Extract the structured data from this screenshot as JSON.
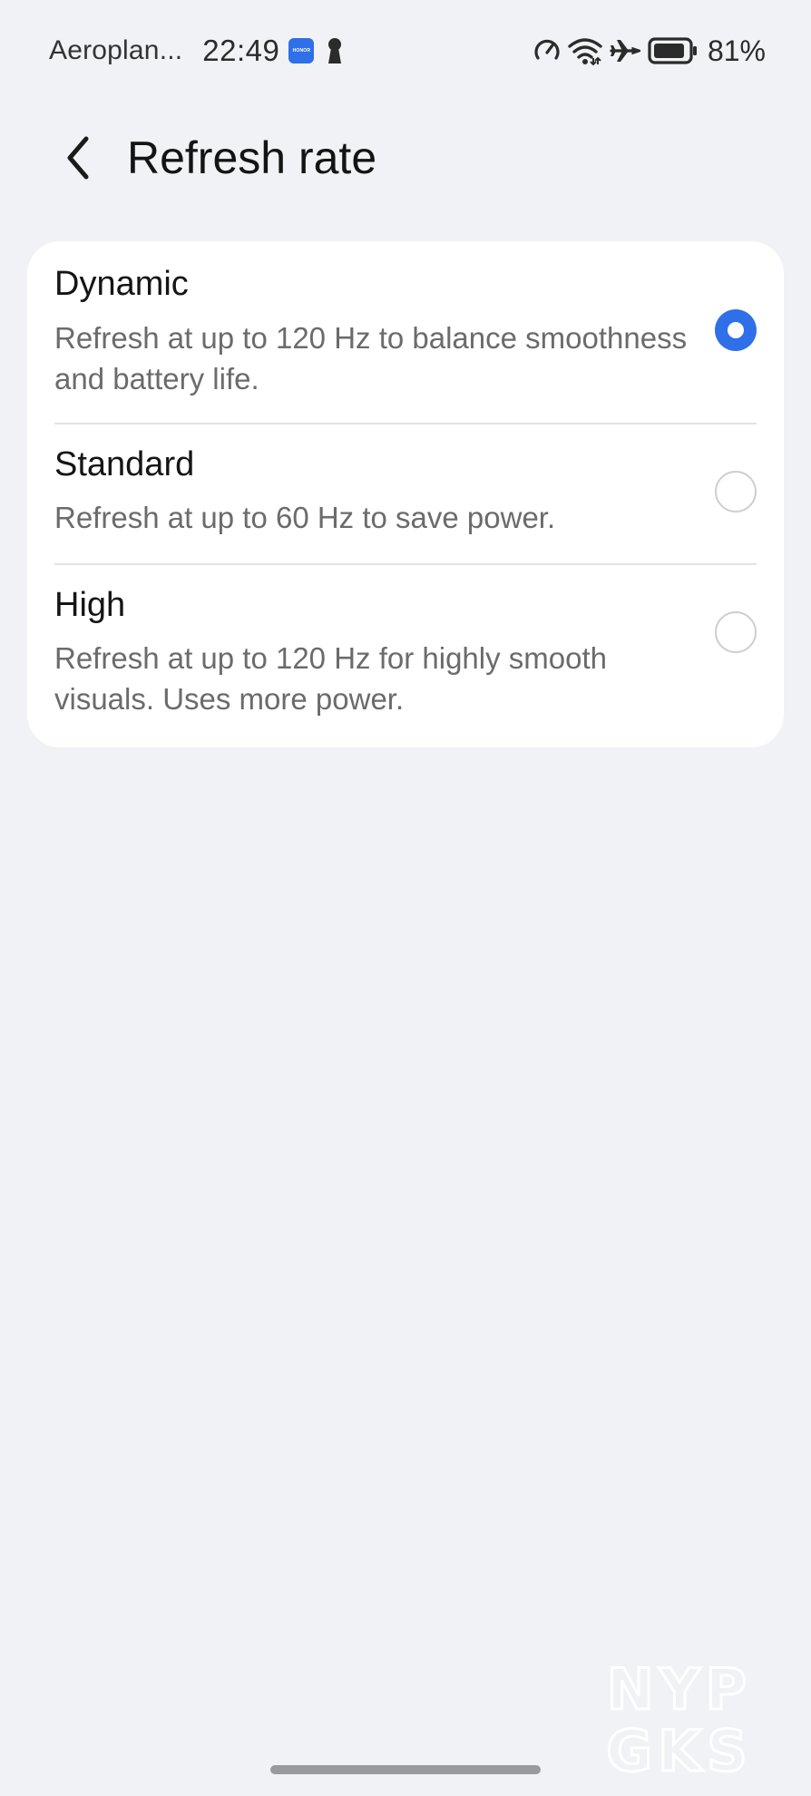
{
  "status_bar": {
    "carrier": "Aeroplan...",
    "time": "22:49",
    "app_badge_label": "HONOR",
    "battery_percent": "81%",
    "icons": [
      "honor-app-icon",
      "keyhole-icon",
      "speed-icon",
      "wifi-icon",
      "airplane-icon",
      "battery-icon"
    ]
  },
  "header": {
    "title": "Refresh rate",
    "back_icon": "chevron-left-icon"
  },
  "options": [
    {
      "title": "Dynamic",
      "description": "Refresh at up to 120 Hz to balance smoothness and battery life.",
      "selected": true
    },
    {
      "title": "Standard",
      "description": "Refresh at up to 60 Hz to save power.",
      "selected": false
    },
    {
      "title": "High",
      "description": "Refresh at up to 120 Hz for highly smooth visuals. Uses more power.",
      "selected": false
    }
  ],
  "watermark": {
    "line1": "NYP",
    "line2": "GKS"
  },
  "colors": {
    "accent": "#2f6fe8",
    "background": "#f1f2f6",
    "card": "#ffffff",
    "secondary_text": "#6b6b6b"
  }
}
